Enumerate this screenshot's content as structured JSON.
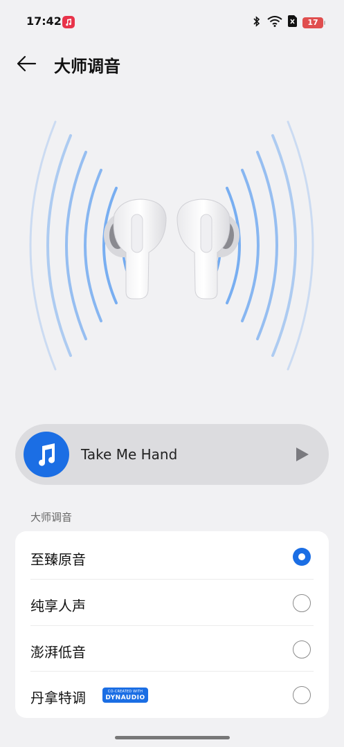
{
  "status_bar": {
    "time": "17:42",
    "app_icon": "music-app-icon",
    "icons": [
      "bluetooth-icon",
      "wifi-icon",
      "sim-disabled-icon"
    ],
    "battery_level": "17"
  },
  "header": {
    "back_icon": "back-arrow-icon",
    "title": "大师调音"
  },
  "hero": {
    "image": "earbuds-illustration",
    "accent_color": "#5a9df0"
  },
  "player": {
    "album_icon": "music-note-icon",
    "track_title": "Take Me Hand",
    "play_icon": "play-icon"
  },
  "section": {
    "label": "大师调音",
    "options": [
      {
        "label": "至臻原音",
        "selected": true
      },
      {
        "label": "纯享人声",
        "selected": false
      },
      {
        "label": "澎湃低音",
        "selected": false
      },
      {
        "label": "丹拿特调",
        "selected": false,
        "badge_top": "CO-CREATED WITH",
        "badge_bottom": "DYNAUDIO"
      }
    ]
  },
  "colors": {
    "background": "#f1f1f3",
    "accent": "#1b6ee4",
    "card": "#ffffff",
    "player_bg": "#dcdcdf"
  }
}
